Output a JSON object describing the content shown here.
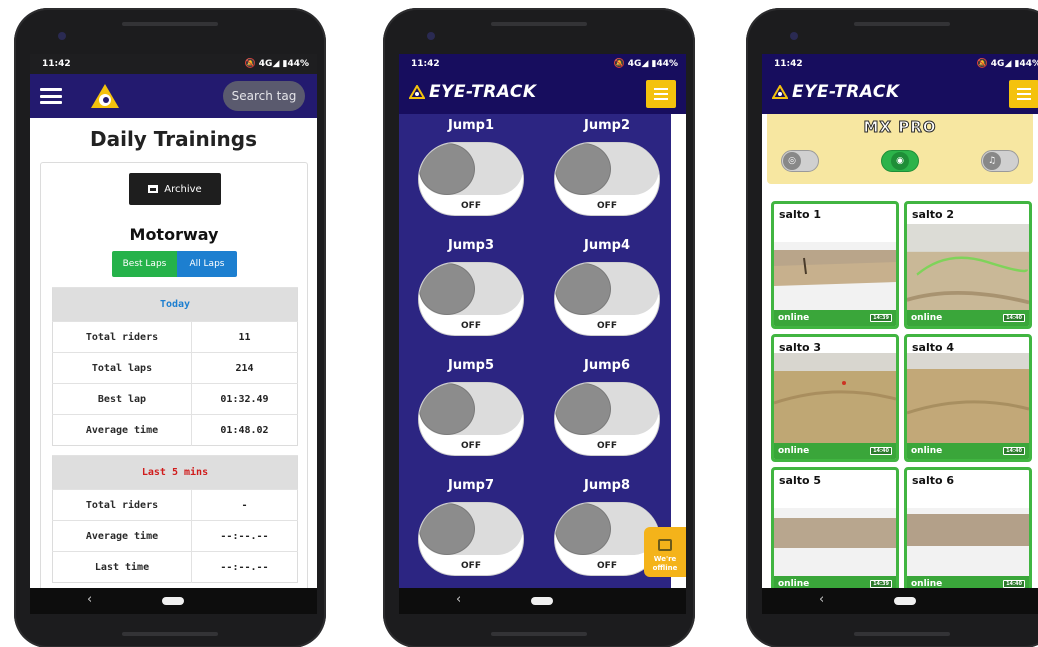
{
  "status": {
    "time": "11:42",
    "icons": "🔕 4G◢ ▮44%"
  },
  "screen1": {
    "search_label": "Search tag",
    "title": "Daily Trainings",
    "archive_label": "Archive",
    "track_name": "Motorway",
    "best_laps_label": "Best Laps",
    "all_laps_label": "All Laps",
    "today": {
      "heading": "Today",
      "heading_color": "#1d7fd0",
      "rows": [
        {
          "label": "Total riders",
          "value": "11"
        },
        {
          "label": "Total laps",
          "value": "214"
        },
        {
          "label": "Best lap",
          "value": "01:32.49"
        },
        {
          "label": "Average time",
          "value": "01:48.02"
        }
      ]
    },
    "last5": {
      "heading": "Last 5 mins",
      "heading_color": "#d01c1c",
      "rows": [
        {
          "label": "Total riders",
          "value": "-"
        },
        {
          "label": "Average time",
          "value": "--:--.--"
        },
        {
          "label": "Last time",
          "value": "--:--.--"
        }
      ]
    }
  },
  "screen2": {
    "brand": "EYE-TRACK",
    "jumps": [
      {
        "label": "Jump1",
        "state": "OFF"
      },
      {
        "label": "Jump2",
        "state": "OFF"
      },
      {
        "label": "Jump3",
        "state": "OFF"
      },
      {
        "label": "Jump4",
        "state": "OFF"
      },
      {
        "label": "Jump5",
        "state": "OFF"
      },
      {
        "label": "Jump6",
        "state": "OFF"
      },
      {
        "label": "Jump7",
        "state": "OFF"
      },
      {
        "label": "Jump8",
        "state": "OFF"
      }
    ],
    "offline_line1": "We're",
    "offline_line2": "offline"
  },
  "screen3": {
    "brand": "EYE-TRACK",
    "panel_title": "MX PRO",
    "cameras": [
      {
        "name": "salto 1",
        "status": "online",
        "stamp": "14:39"
      },
      {
        "name": "salto 2",
        "status": "online",
        "stamp": "14:40"
      },
      {
        "name": "salto 3",
        "status": "online",
        "stamp": "14:40"
      },
      {
        "name": "salto 4",
        "status": "online",
        "stamp": "14:40"
      },
      {
        "name": "salto 5",
        "status": "online",
        "stamp": "14:39"
      },
      {
        "name": "salto 6",
        "status": "online",
        "stamp": "14:40"
      }
    ]
  },
  "colors": {
    "header_navy": "#231a6f",
    "jump_bg": "#2c2582",
    "accent_yellow": "#f4c20d",
    "online_green": "#3aa63a"
  }
}
